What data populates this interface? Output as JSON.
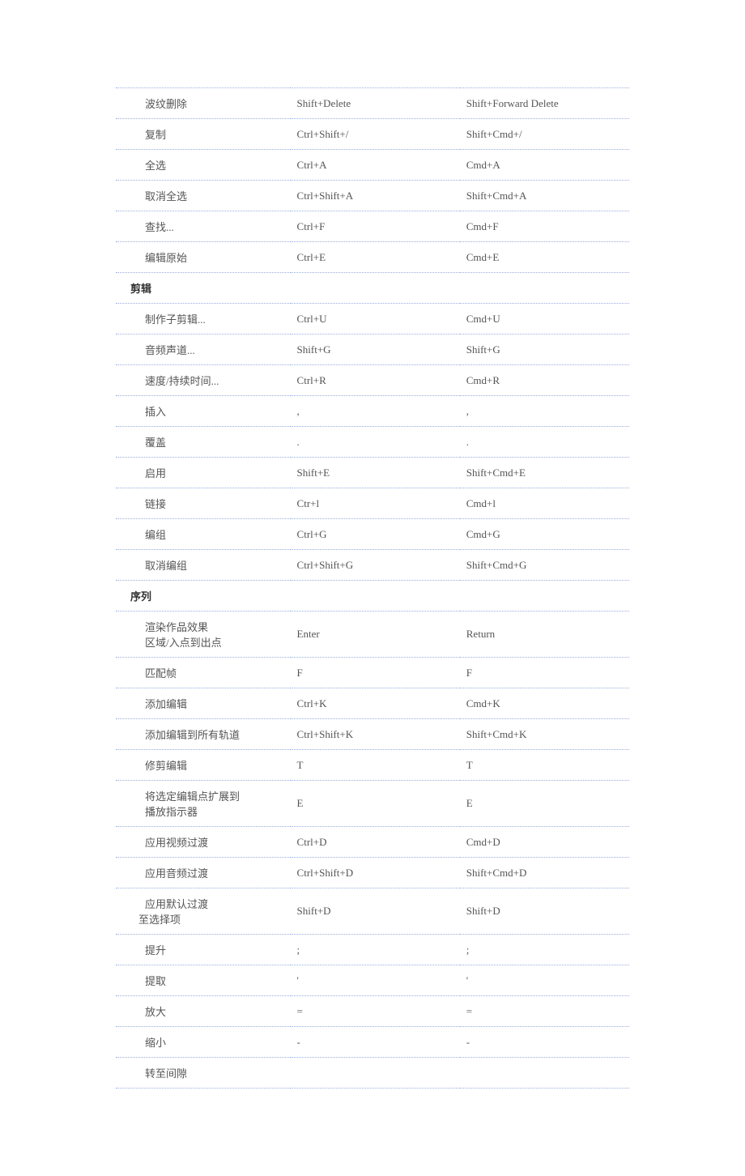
{
  "rows": [
    {
      "t": "item",
      "name": "波纹删除",
      "win": "Shift+Delete",
      "mac": "Shift+Forward Delete"
    },
    {
      "t": "item",
      "name": "复制",
      "win": "Ctrl+Shift+/",
      "mac": "Shift+Cmd+/"
    },
    {
      "t": "item",
      "name": "全选",
      "win": "Ctrl+A",
      "mac": "Cmd+A"
    },
    {
      "t": "item",
      "name": "取消全选",
      "win": "Ctrl+Shift+A",
      "mac": "Shift+Cmd+A"
    },
    {
      "t": "item",
      "name": "查找...",
      "win": "Ctrl+F",
      "mac": "Cmd+F"
    },
    {
      "t": "item",
      "name": "编辑原始",
      "win": "Ctrl+E",
      "mac": "Cmd+E"
    },
    {
      "t": "header",
      "name": "剪辑",
      "win": "",
      "mac": ""
    },
    {
      "t": "item",
      "name": "制作子剪辑...",
      "win": "Ctrl+U",
      "mac": "Cmd+U"
    },
    {
      "t": "item",
      "name": "音频声道...",
      "win": "Shift+G",
      "mac": "Shift+G"
    },
    {
      "t": "item",
      "name": "速度/持续时间...",
      "win": "Ctrl+R",
      "mac": "Cmd+R"
    },
    {
      "t": "item",
      "name": "插入",
      "win": ",",
      "mac": ","
    },
    {
      "t": "item",
      "name": "覆盖",
      "win": ".",
      "mac": "."
    },
    {
      "t": "item",
      "name": "启用",
      "win": "Shift+E",
      "mac": "Shift+Cmd+E"
    },
    {
      "t": "item",
      "name": "链接",
      "win": "Ctr+l",
      "mac": "Cmd+l"
    },
    {
      "t": "item",
      "name": "编组",
      "win": "Ctrl+G",
      "mac": "Cmd+G"
    },
    {
      "t": "item",
      "name": "取消编组",
      "win": "Ctrl+Shift+G",
      "mac": "Shift+Cmd+G"
    },
    {
      "t": "header",
      "name": "序列",
      "win": "",
      "mac": ""
    },
    {
      "t": "item2",
      "name1": "渲染作品效果",
      "name2": "区域/入点到出点",
      "win": "Enter",
      "mac": "Return"
    },
    {
      "t": "item",
      "name": "匹配帧",
      "win": "F",
      "mac": "F"
    },
    {
      "t": "item",
      "name": "添加编辑",
      "win": "Ctrl+K",
      "mac": "Cmd+K"
    },
    {
      "t": "item",
      "name": "添加编辑到所有轨道",
      "win": "Ctrl+Shift+K",
      "mac": "Shift+Cmd+K"
    },
    {
      "t": "item",
      "name": "修剪编辑",
      "win": "T",
      "mac": "T"
    },
    {
      "t": "item2",
      "name1": "将选定编辑点扩展到",
      "name2": "播放指示器",
      "win": "E",
      "mac": "E"
    },
    {
      "t": "item",
      "name": "应用视频过渡",
      "win": "Ctrl+D",
      "mac": "Cmd+D"
    },
    {
      "t": "item",
      "name": "应用音频过渡",
      "win": "Ctrl+Shift+D",
      "mac": "Shift+Cmd+D"
    },
    {
      "t": "item2b",
      "name1": "应用默认过渡",
      "name2": "至选择项",
      "win": "Shift+D",
      "mac": "Shift+D"
    },
    {
      "t": "item",
      "name": "提升",
      "win": ";",
      "mac": ";"
    },
    {
      "t": "item",
      "name": "提取",
      "win": "'",
      "mac": "'"
    },
    {
      "t": "item",
      "name": "放大",
      "win": "=",
      "mac": "="
    },
    {
      "t": "item",
      "name": "缩小",
      "win": "-",
      "mac": "-"
    },
    {
      "t": "item",
      "name": "转至间隙",
      "win": "",
      "mac": ""
    }
  ]
}
